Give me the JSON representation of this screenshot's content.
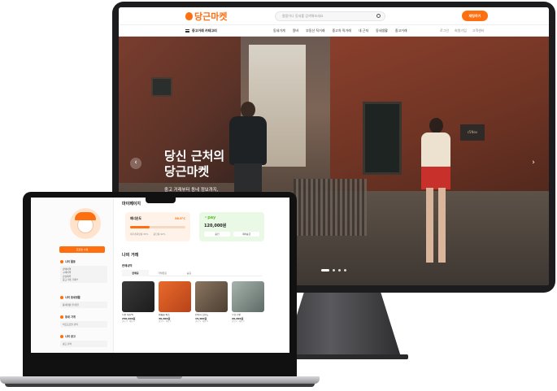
{
  "desktop": {
    "logo": "당근마켓",
    "search_placeholder": "물품이나 동네를 검색해보세요",
    "header_button": "채팅하기",
    "nav": {
      "category": "중고거래 카테고리",
      "links": [
        "동네가게",
        "알바",
        "부동산 직거래",
        "중고차 직거래",
        "내 근처",
        "동네생활",
        "중고거래"
      ],
      "utility": [
        "로그인",
        "회원가입",
        "고객센터"
      ]
    },
    "hero": {
      "title": "당신 근처의\n당근마켓",
      "subtitle": "중고 거래부터 동네 정보까지,\n이웃과 함께해요. 가깝고 따뜻한 당신의 근처를 만들어요.",
      "sign": "c5Nov",
      "slide_count": 4,
      "active_slide": 0
    }
  },
  "laptop": {
    "sidebar": {
      "profile_button": "프로필 수정",
      "sections": [
        {
          "title": "나의 활동",
          "items": [
            "판매내역",
            "구매내역",
            "관심목록",
            "중고거래 가계부"
          ]
        },
        {
          "title": "나의 동네생활",
          "items": [
            "동네생활 글/댓글"
          ]
        },
        {
          "title": "동네 가게",
          "items": [
            "비즈프로필 관리"
          ]
        },
        {
          "title": "나의 광고",
          "items": [
            "광고 관리"
          ]
        }
      ]
    },
    "main": {
      "title": "마이페이지",
      "manner": {
        "label": "매너온도",
        "value": "36.5°C",
        "fill": 0.36,
        "stats": [
          "재거래희망률 95%",
          "응답률 92%"
        ]
      },
      "pay": {
        "label": "pay",
        "amount": "120,000원",
        "buttons": [
          "충전",
          "계좌송금"
        ]
      },
      "section_title": "나의 거래",
      "subsection_title": "판매내역",
      "tabs": [
        "판매중",
        "거래완료",
        "숨김"
      ],
      "items": [
        {
          "title": "디올 새들백",
          "price": "250,000원",
          "meta": "관심 3 · 채팅 2",
          "color": "#2b2b2b"
        },
        {
          "title": "캠핑용 박스",
          "price": "30,000원",
          "meta": "관심 1 · 채팅 1",
          "color": "#d9531e"
        },
        {
          "title": "빈티지 스탠드",
          "price": "15,000원",
          "meta": "관심 4 · 채팅 0",
          "color": "#6f5b48"
        },
        {
          "title": "수납 선반",
          "price": "20,000원",
          "meta": "관심 2 · 채팅 1",
          "color": "#7c8b86"
        }
      ]
    }
  }
}
